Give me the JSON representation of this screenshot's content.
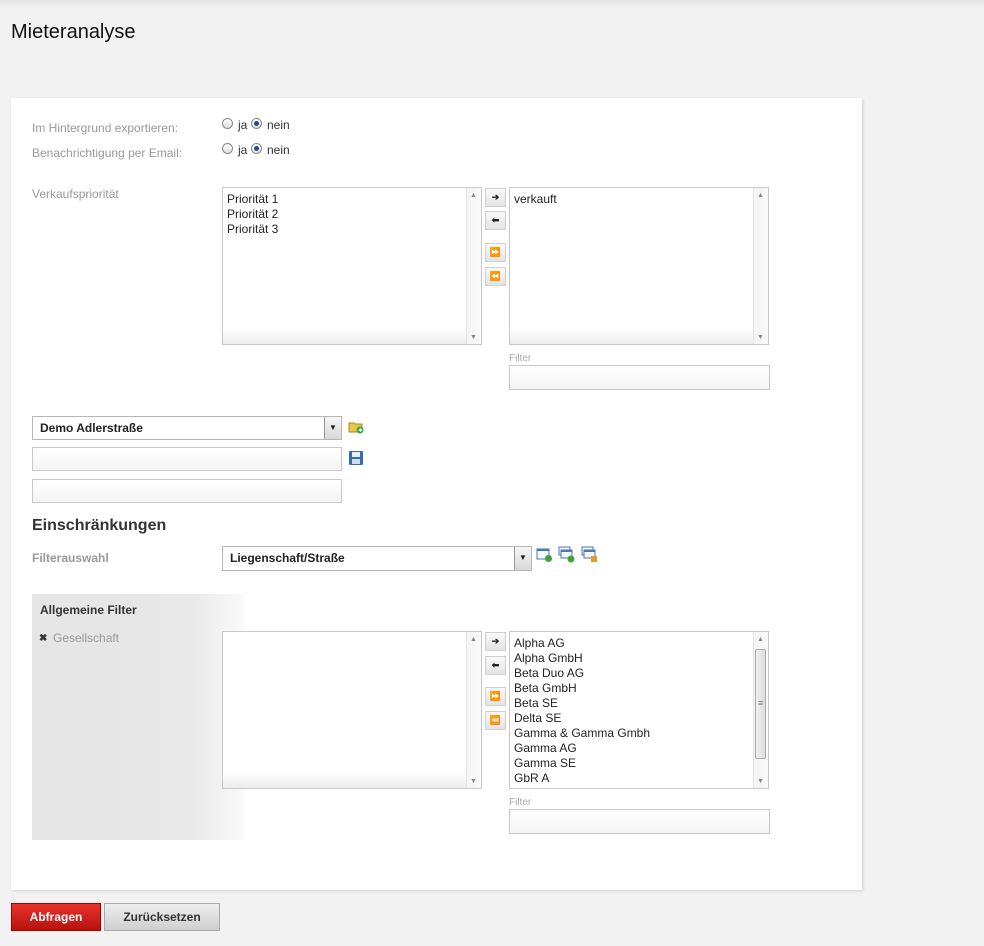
{
  "page": {
    "title": "Mieteranalyse"
  },
  "export": {
    "background_label": "Im Hintergrund exportieren:",
    "email_label": "Benachrichtigung per Email:",
    "yes": "ja",
    "no": "nein",
    "background_value": "nein",
    "email_value": "nein"
  },
  "priority": {
    "label": "Verkaufspriorität",
    "available": [
      "Priorität 1",
      "Priorität 2",
      "Priorität 3"
    ],
    "selected": [
      "verkauft"
    ],
    "filter_label": "Filter",
    "filter_value": ""
  },
  "preset": {
    "selected": "Demo Adlerstraße",
    "name_value": "",
    "desc_value": ""
  },
  "restrictions": {
    "heading": "Einschränkungen",
    "filter_select_label": "Filterauswahl",
    "filter_select_value": "Liegenschaft/Straße",
    "general_filters_title": "Allgemeine Filter",
    "general_filter_item": "Gesellschaft",
    "available": [],
    "selected": [
      "Alpha AG",
      "Alpha GmbH",
      "Beta Duo AG",
      "Beta GmbH",
      "Beta SE",
      "Delta SE",
      "Gamma & Gamma Gmbh",
      "Gamma AG",
      "Gamma SE",
      "GbR A"
    ],
    "filter_label": "Filter",
    "filter_value": ""
  },
  "move_buttons": {
    "add": "➔",
    "remove": "⬅",
    "add_all": "⏩",
    "remove_all": "⏪"
  },
  "actions": {
    "query": "Abfragen",
    "reset": "Zurücksetzen"
  },
  "colors": {
    "primary_button": "#c8161d",
    "radio_selected": "#1f4f8c"
  }
}
